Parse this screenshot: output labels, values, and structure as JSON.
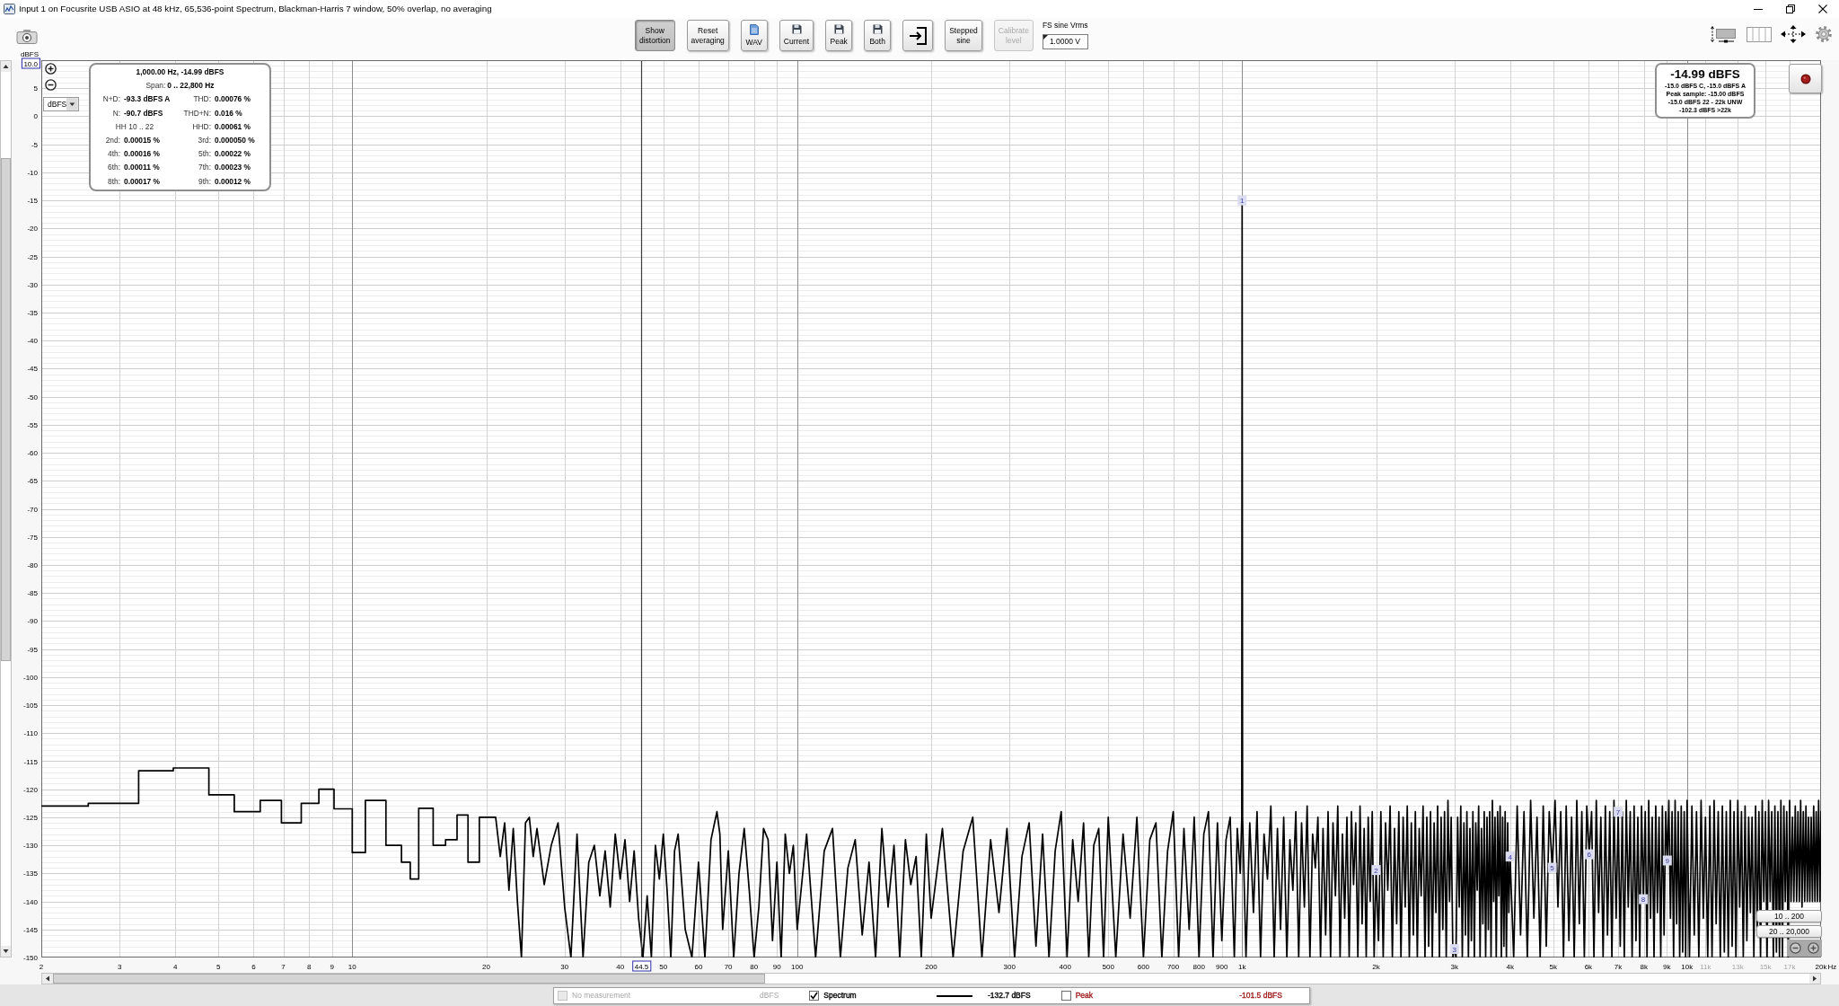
{
  "window": {
    "title": "Input 1 on Focusrite USB ASIO at 48 kHz, 65,536-point Spectrum, Blackman-Harris 7 window, 50% overlap, no averaging"
  },
  "toolbar": {
    "buttons": [
      {
        "kind": "toggle",
        "label": "Show distortion",
        "pressed": true,
        "disabled": false
      },
      {
        "kind": "text",
        "label": "Reset averaging",
        "pressed": false,
        "disabled": false
      },
      {
        "kind": "file",
        "label": "WAV",
        "pressed": false,
        "disabled": false
      },
      {
        "kind": "save",
        "label": "Current",
        "pressed": false,
        "disabled": false
      },
      {
        "kind": "save",
        "label": "Peak",
        "pressed": false,
        "disabled": false
      },
      {
        "kind": "save",
        "label": "Both",
        "pressed": false,
        "disabled": false
      },
      {
        "kind": "import",
        "pressed": false,
        "disabled": false
      },
      {
        "kind": "text",
        "label": "Stepped sine",
        "pressed": false,
        "disabled": false
      },
      {
        "kind": "text",
        "label": "Calibrate level",
        "pressed": false,
        "disabled": true
      }
    ],
    "fs_sine": {
      "label": "FS sine Vrms",
      "value": "1.0000 V"
    }
  },
  "graph": {
    "unit_select": {
      "value": "dBFS"
    },
    "y_readout": "10.0",
    "info_box": {
      "title": "1,000.00 Hz, -14.99 dBFS",
      "span": {
        "label": "Span:",
        "value": "0 .. 22,800 Hz"
      },
      "measurements": [
        {
          "label": "N+D:",
          "value": "-93.3 dBFS A"
        },
        {
          "label": "THD:",
          "value": "0.00076 %"
        },
        {
          "label": "N:",
          "value": "-90.7 dBFS"
        },
        {
          "label": "THD+N:",
          "value": "0.016 %"
        },
        {
          "label": "HH 10 .. 22"
        },
        {
          "label": "HHD:",
          "value": "0.00061 %"
        },
        {
          "label": "2nd:",
          "value": "0.00015 %"
        },
        {
          "label": "3rd:",
          "value": "0.000050 %"
        },
        {
          "label": "4th:",
          "value": "0.00016 %"
        },
        {
          "label": "5th:",
          "value": "0.00022 %"
        },
        {
          "label": "6th:",
          "value": "0.00011 %"
        },
        {
          "label": "7th:",
          "value": "0.00023 %"
        },
        {
          "label": "8th:",
          "value": "0.00017 %"
        },
        {
          "label": "9th:",
          "value": "0.00012 %"
        }
      ]
    },
    "level_box": {
      "reading": "-14.99 dBFS",
      "details": [
        "-15.0 dBFS C, -15.0 dBFS A",
        "Peak sample: -15.00 dBFS",
        "-15.0 dBFS 22 - 22k UNW",
        "-102.3 dBFS >22k"
      ]
    },
    "range_buttons": [
      "10 .. 200",
      "20 .. 20,000"
    ],
    "chart_data": {
      "type": "line",
      "xlabel": "Hz",
      "ylabel": "dBFS",
      "log": "x",
      "grid": true,
      "xlim": [
        2,
        20000
      ],
      "ylim": [
        -150,
        10
      ],
      "xticks": [
        2,
        3,
        4,
        5,
        6,
        7,
        8,
        9,
        10,
        20,
        30,
        40,
        50,
        60,
        70,
        80,
        90,
        100,
        200,
        300,
        400,
        500,
        600,
        700,
        800,
        900,
        {
          "value": 1000,
          "label": "1k"
        },
        {
          "value": 2000,
          "label": "2k"
        },
        {
          "value": 3000,
          "label": "3k"
        },
        {
          "value": 4000,
          "label": "4k"
        },
        {
          "value": 5000,
          "label": "5k"
        },
        {
          "value": 6000,
          "label": "6k"
        },
        {
          "value": 7000,
          "label": "7k"
        },
        {
          "value": 8000,
          "label": "8k"
        },
        {
          "value": 9000,
          "label": "9k"
        },
        {
          "value": 10000,
          "label": "10k"
        },
        {
          "value": 11000,
          "label": "11k"
        },
        {
          "value": 13000,
          "label": "13k"
        },
        {
          "value": 15000,
          "label": "15k"
        },
        {
          "value": 17000,
          "label": "17k"
        },
        {
          "value": 20000,
          "label": "20k"
        }
      ],
      "yticks": [
        5,
        0,
        -5,
        -10,
        -15,
        -20,
        -25,
        -30,
        -35,
        -40,
        -45,
        -50,
        -55,
        -60,
        -65,
        -70,
        -75,
        -80,
        -85,
        -90,
        -95,
        -100,
        -105,
        -110,
        -115,
        -120,
        -125,
        -130,
        -135,
        -140,
        -145,
        -150
      ],
      "x": [
        2,
        2.55,
        2.55,
        3.31,
        3.31,
        3.96,
        3.96,
        4.76,
        4.76,
        5.43,
        5.43,
        6.21,
        6.21,
        6.93,
        6.93,
        7.68,
        7.68,
        8.41,
        8.41,
        9.1,
        9.1,
        10,
        10,
        10.7,
        10.7,
        11.9,
        11.9,
        12.9,
        12.9,
        13.5,
        13.5,
        14.1,
        14.1,
        15.2,
        15.2,
        16.2,
        16.2,
        17.2,
        17.2,
        18.2,
        18.2,
        19.3,
        19.3,
        20.6,
        21,
        21.5,
        22,
        22.5,
        23,
        23.5,
        24,
        24.5,
        25,
        25.5,
        26,
        27,
        28,
        29,
        30,
        31,
        32,
        33,
        34,
        35,
        36,
        37,
        38,
        39,
        40,
        41,
        42,
        43,
        44,
        45,
        46,
        47,
        48,
        49,
        50,
        51,
        52,
        53,
        54,
        56,
        58,
        60,
        62,
        64,
        66,
        67,
        68,
        70,
        72,
        74,
        76,
        78,
        80,
        82,
        84,
        86,
        88,
        90,
        92,
        94,
        96,
        98,
        100,
        105,
        110,
        115,
        120,
        125,
        130,
        135,
        140,
        145,
        150,
        155,
        160,
        165,
        170,
        175,
        180,
        185,
        190,
        195,
        200,
        212,
        224,
        236,
        248,
        260,
        272,
        284,
        296,
        308,
        320,
        332,
        344,
        356,
        368,
        380,
        392,
        404,
        416,
        428,
        440,
        452,
        464,
        476,
        488,
        500,
        520,
        540,
        560,
        580,
        600,
        620,
        640,
        660,
        680,
        700,
        720,
        740,
        760,
        780,
        800,
        820,
        840,
        860,
        880,
        900,
        920,
        940,
        960,
        975,
        990,
        998,
        1000,
        1002,
        1020,
        1040,
        1060,
        1080,
        1100,
        1120,
        1140,
        1160,
        1180,
        1200,
        1220,
        1240,
        1260,
        1280,
        1300,
        1320,
        1340,
        1360,
        1380,
        1400,
        1420,
        1440,
        1460,
        1480,
        1500,
        1520,
        1540,
        1560,
        1580,
        1600,
        1620,
        1640,
        1660,
        1680,
        1700,
        1720,
        1740,
        1760,
        1780,
        1800,
        1820,
        1840,
        1860,
        1880,
        1900,
        1920,
        1940,
        1960,
        1980,
        2000,
        2025,
        2050,
        2075,
        2100,
        2125,
        2150,
        2175,
        2200,
        2225,
        2250,
        2275,
        2300,
        2325,
        2350,
        2375,
        2400,
        2425,
        2450,
        2475,
        2500,
        2525,
        2550,
        2575,
        2600,
        2625,
        2650,
        2675,
        2700,
        2725,
        2750,
        2775,
        2800,
        2825,
        2850,
        2875,
        2900,
        2925,
        2950,
        2975,
        3000,
        3025,
        3050,
        3075,
        3100,
        3125,
        3150,
        3175,
        3200,
        3225,
        3250,
        3275,
        3300,
        3325,
        3350,
        3375,
        3400,
        3425,
        3450,
        3475,
        3500,
        3525,
        3550,
        3575,
        3600,
        3625,
        3650,
        3675,
        3700,
        3725,
        3750,
        3775,
        3800,
        3825,
        3850,
        3875,
        3900,
        3925,
        3950,
        3975,
        4000,
        4075,
        4150,
        4225,
        4300,
        4375,
        4450,
        4525,
        4600,
        4675,
        4750,
        4825,
        4900,
        4975,
        5050,
        5125,
        5200,
        5275,
        5350,
        5425,
        5500,
        5575,
        5650,
        5725,
        5800,
        5875,
        5950,
        6025,
        6100,
        6175,
        6250,
        6325,
        6400,
        6475,
        6550,
        6625,
        6700,
        6775,
        6850,
        6925,
        7000,
        7075,
        7150,
        7225,
        7300,
        7375,
        7450,
        7525,
        7600,
        7675,
        7750,
        7825,
        7900,
        7975,
        8050,
        8125,
        8200,
        8275,
        8350,
        8425,
        8500,
        8575,
        8650,
        8725,
        8800,
        8875,
        8950,
        9025,
        9100,
        9175,
        9250,
        9325,
        9400,
        9475,
        9550,
        9625,
        9700,
        9775,
        9850,
        9925,
        10000,
        10125,
        10250,
        10375,
        10500,
        10625,
        10750,
        10875,
        11000,
        11125,
        11250,
        11375,
        11500,
        11625,
        11750,
        11875,
        12000,
        12125,
        12250,
        12375,
        12500,
        12625,
        12750,
        12875,
        13000,
        13125,
        13250,
        13375,
        13500,
        13625,
        13750,
        13875,
        14000,
        14125,
        14250,
        14375,
        14500,
        14625,
        14750,
        14875,
        15000,
        15125,
        15250,
        15375,
        15500,
        15625,
        15750,
        15875,
        16000,
        16125,
        16250,
        16375,
        16500,
        16625,
        16750,
        16875,
        17000,
        17125,
        17250,
        17375,
        17500,
        17625,
        17750,
        17875,
        18000,
        18125,
        18250,
        18375,
        18500,
        18625,
        18750,
        18875,
        19000,
        19125,
        19250,
        19375,
        19500,
        19625,
        19750,
        19875,
        20000
      ],
      "series": [
        {
          "color": "#000000",
          "values": [
            -123,
            -123,
            -122.5,
            -122.5,
            -116.7,
            -116.7,
            -116.2,
            -116.2,
            -121,
            -121,
            -124,
            -124,
            -122,
            -122,
            -126,
            -126,
            -122.5,
            -122.5,
            -120,
            -120,
            -123.5,
            -123.5,
            -131.3,
            -131.3,
            -122,
            -122,
            -130,
            -130,
            -133,
            -133,
            -136,
            -136,
            -123.4,
            -123.4,
            -130,
            -130,
            -129,
            -129,
            -124.6,
            -124.6,
            -133,
            -133,
            -125,
            -125,
            -125,
            -132,
            -126,
            -138,
            -127,
            -140,
            -150,
            -126,
            -125,
            -132,
            -127,
            -137,
            -130,
            -126,
            -141,
            -150,
            -128,
            -150,
            -133,
            -130,
            -139,
            -131,
            -141,
            -128,
            -136,
            -129,
            -140,
            -131,
            -143,
            -150,
            -139,
            -150,
            -130,
            -136,
            -128,
            -138,
            -150,
            -131,
            -128,
            -145,
            -150,
            -133,
            -150,
            -129,
            -124,
            -128,
            -145,
            -131,
            -150,
            -135,
            -127,
            -138,
            -150,
            -141,
            -127,
            -129,
            -147,
            -133,
            -150,
            -128,
            -135,
            -130,
            -145,
            -128,
            -150,
            -131,
            -127,
            -150,
            -134,
            -129,
            -146,
            -133,
            -150,
            -127,
            -141,
            -130,
            -150,
            -129,
            -137,
            -132,
            -150,
            -128,
            -143,
            -127,
            -150,
            -131,
            -125,
            -150,
            -129,
            -142,
            -127,
            -150,
            -132,
            -126,
            -148,
            -128,
            -150,
            -131,
            -124,
            -150,
            -129,
            -140,
            -126,
            -150,
            -130,
            -127,
            -150,
            -125,
            -150,
            -128,
            -143,
            -125,
            -150,
            -129,
            -126,
            -150,
            -131,
            -124,
            -150,
            -127,
            -145,
            -125,
            -150,
            -128,
            -124,
            -150,
            -126,
            -147,
            -129,
            -125,
            -150,
            -127,
            -135,
            -125,
            -15,
            -125,
            -150,
            -126,
            -142,
            -124,
            -150,
            -128,
            -136,
            -123,
            -150,
            -127,
            -145,
            -125,
            -150,
            -129,
            -138,
            -124,
            -150,
            -126,
            -141,
            -123,
            -150,
            -128,
            -134,
            -125,
            -150,
            -127,
            -146,
            -124,
            -150,
            -126,
            -139,
            -123,
            -150,
            -128,
            -143,
            -125,
            -150,
            -124,
            -137,
            -126,
            -150,
            -123,
            -144,
            -127,
            -150,
            -125,
            -140,
            -124,
            -150,
            -134.4,
            -147,
            -124,
            -150,
            -126,
            -138,
            -123,
            -150,
            -127,
            -144,
            -124,
            -150,
            -125,
            -141,
            -123,
            -150,
            -126,
            -146,
            -124,
            -150,
            -127,
            -139,
            -123,
            -150,
            -125,
            -148,
            -124,
            -150,
            -126,
            -142,
            -123,
            -150,
            -125,
            -145,
            -124,
            -150,
            -122,
            -140,
            -125,
            -150,
            -148.5,
            -150,
            -125,
            -141,
            -123,
            -150,
            -126,
            -146,
            -124,
            -150,
            -127,
            -147,
            -124,
            -150,
            -126,
            -138,
            -123,
            -150,
            -127,
            -144,
            -124,
            -150,
            -125,
            -145,
            -124,
            -150,
            -122,
            -140,
            -125,
            -150,
            -124,
            -139,
            -123,
            -150,
            -125,
            -148,
            -124,
            -150,
            -126,
            -142,
            -132,
            -150,
            -123,
            -146,
            -124,
            -150,
            -122,
            -143,
            -125,
            -150,
            -123,
            -148,
            -124,
            -134,
            -122,
            -141,
            -124,
            -150,
            -123,
            -147,
            -125,
            -150,
            -122,
            -144,
            -124,
            -150,
            -123,
            -131.6,
            -124,
            -150,
            -122,
            -142,
            -125,
            -150,
            -123,
            -146,
            -124,
            -150,
            -122,
            -143,
            -124,
            -148,
            -124,
            -150,
            -122,
            -141,
            -124,
            -150,
            -123,
            -147,
            -125,
            -150,
            -123,
            -139.6,
            -124,
            -150,
            -122,
            -143,
            -125,
            -150,
            -123,
            -142,
            -125,
            -150,
            -123,
            -146,
            -124,
            -132.7,
            -122,
            -143,
            -124,
            -150,
            -122,
            -144,
            -124,
            -150,
            -123,
            -149,
            -124,
            -150,
            -122,
            -150,
            -123,
            -146,
            -124,
            -150,
            -122,
            -143,
            -125,
            -150,
            -123,
            -150,
            -122,
            -144,
            -124,
            -150,
            -123,
            -149,
            -124,
            -150,
            -122,
            -148,
            -124,
            -150,
            -122,
            -141,
            -124,
            -150,
            -123,
            -147,
            -125,
            -142,
            -125,
            -150,
            -123,
            -146,
            -124,
            -150,
            -122,
            -140,
            -124,
            -150,
            -122,
            -140,
            -124,
            -150,
            -123,
            -149,
            -124,
            -150,
            -122,
            -150,
            -123,
            -140,
            -124,
            -150,
            -122,
            -140,
            -125,
            -140,
            -123,
            -140,
            -124,
            -140,
            -122,
            -141,
            -124,
            -140,
            -123,
            -140,
            -125,
            -140,
            -125,
            -140,
            -123,
            -140,
            -124,
            -140,
            -122,
            -140,
            -124
          ]
        }
      ],
      "annotations": [
        {
          "x": 1000,
          "y": -15,
          "text": "1"
        },
        {
          "x": 2000,
          "y": -134.4,
          "text": "2"
        },
        {
          "x": 3000,
          "y": -148.5,
          "text": "3"
        },
        {
          "x": 4000,
          "y": -132,
          "text": "4"
        },
        {
          "x": 4975,
          "y": -134,
          "text": "5"
        },
        {
          "x": 6025,
          "y": -131.6,
          "text": "6"
        },
        {
          "x": 7000,
          "y": -124,
          "text": "7"
        },
        {
          "x": 7975,
          "y": -139.6,
          "text": "8"
        },
        {
          "x": 9025,
          "y": -132.7,
          "text": "9"
        }
      ],
      "ref_lines": [
        {
          "axis": "x",
          "value": 44.5,
          "label": "44.5"
        }
      ]
    }
  },
  "legend": [
    {
      "label": "No measurement",
      "value": "dBFS",
      "checked": false,
      "disabled": true
    },
    {
      "label": "Spectrum",
      "value": "-132.7 dBFS",
      "checked": true,
      "disabled": false,
      "color": "#000000"
    },
    {
      "label": "Peak",
      "value": "-101.5 dBFS",
      "checked": false,
      "disabled": false,
      "color": "#a01c1c"
    }
  ]
}
